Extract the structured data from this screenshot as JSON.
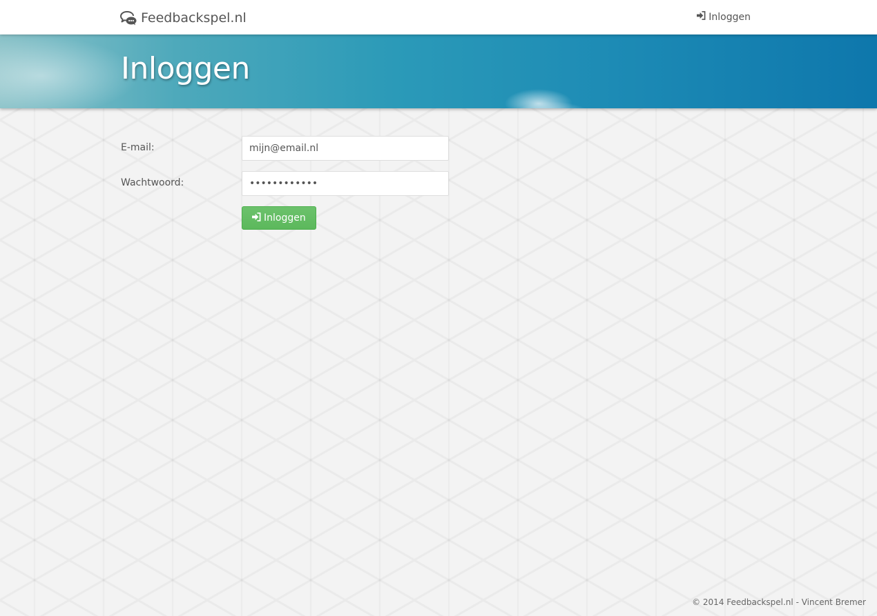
{
  "nav": {
    "brand": "Feedbackspel.nl",
    "brand_icon": "chat-bubbles-icon",
    "login_label": "Inloggen",
    "login_icon": "sign-in-icon"
  },
  "header": {
    "title": "Inloggen"
  },
  "form": {
    "email_label": "E-mail:",
    "email_value": "mijn@email.nl",
    "password_label": "Wachtwoord:",
    "password_value": "••••••••••••",
    "submit_label": "Inloggen",
    "submit_icon": "sign-in-icon",
    "submit_color": "#5cb85c"
  },
  "footer": {
    "text": "© 2014 Feedbackspel.nl - Vincent Bremer"
  }
}
